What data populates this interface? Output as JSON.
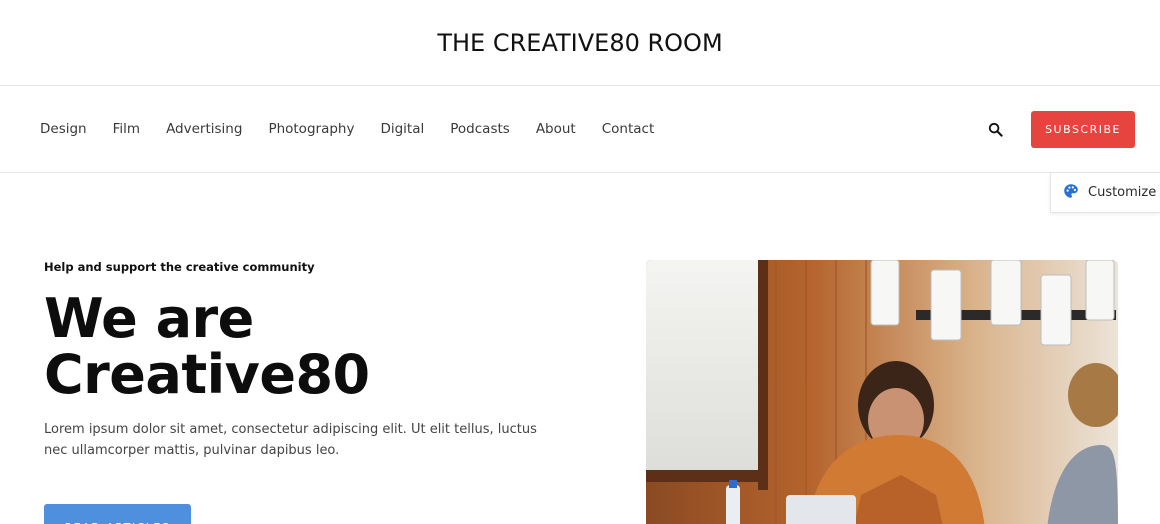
{
  "header": {
    "site_title": "THE CREATIVE80 ROOM"
  },
  "nav": {
    "items": [
      {
        "label": "Design"
      },
      {
        "label": "Film"
      },
      {
        "label": "Advertising"
      },
      {
        "label": "Photography"
      },
      {
        "label": "Digital"
      },
      {
        "label": "Podcasts"
      },
      {
        "label": "About"
      },
      {
        "label": "Contact"
      }
    ],
    "search_icon": "search-icon",
    "subscribe_label": "SUBSCRIBE"
  },
  "customize": {
    "label": "Customize",
    "icon": "palette-icon"
  },
  "hero": {
    "eyebrow": "Help and support the creative community",
    "headline_line1": "We are",
    "headline_line2": "Creative80",
    "lead": "Lorem ipsum dolor sit amet, consectetur adipiscing elit. Ut elit tellus, luctus nec ullamcorper mattis, pulvinar dapibus leo.",
    "button_label": "READ ARTICLES"
  },
  "colors": {
    "subscribe_bg": "#e8443f",
    "read_button_bg": "#4e8fde",
    "customize_icon": "#2a6fd6"
  }
}
